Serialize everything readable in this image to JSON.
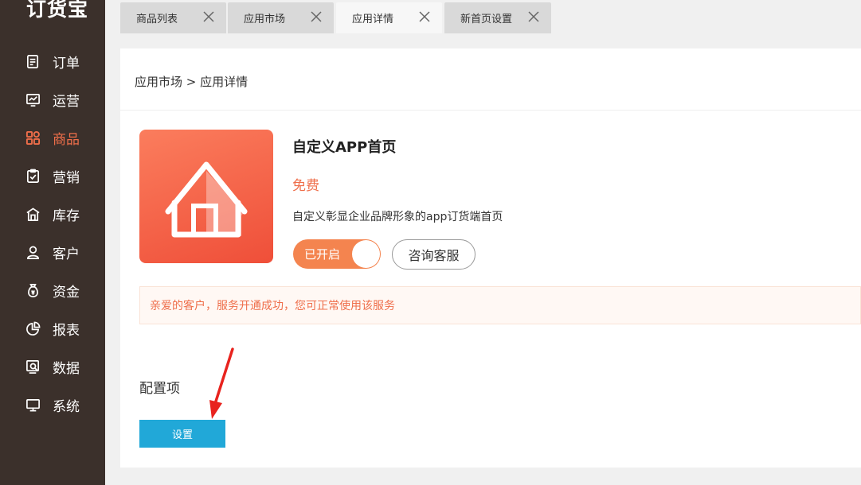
{
  "sidebar": {
    "logo": "订货宝",
    "items": [
      {
        "label": "订单",
        "icon": "order-icon"
      },
      {
        "label": "运营",
        "icon": "operations-chart-icon"
      },
      {
        "label": "商品",
        "icon": "grid-icon",
        "active": true
      },
      {
        "label": "营销",
        "icon": "clipboard-check-icon"
      },
      {
        "label": "库存",
        "icon": "warehouse-icon"
      },
      {
        "label": "客户",
        "icon": "user-icon"
      },
      {
        "label": "资金",
        "icon": "money-bag-icon"
      },
      {
        "label": "报表",
        "icon": "pie-chart-icon"
      },
      {
        "label": "数据",
        "icon": "data-search-icon"
      },
      {
        "label": "系统",
        "icon": "monitor-icon"
      }
    ],
    "active_color": "#ef6e4a"
  },
  "tabs": [
    {
      "label": "商品列表"
    },
    {
      "label": "应用市场"
    },
    {
      "label": "应用详情",
      "active": true
    },
    {
      "label": "新首页设置"
    }
  ],
  "breadcrumb": "应用市场 > 应用详情",
  "app": {
    "title": "自定义APP首页",
    "price": "免费",
    "description": "自定义彰显企业品牌形象的app订货端首页",
    "icon": "house-icon",
    "toggle_label": "已开启",
    "consult_label": "咨询客服"
  },
  "notice": "亲爱的客户，服务开通成功，您可正常使用该服务",
  "config": {
    "title": "配置项",
    "settings_label": "设置"
  },
  "colors": {
    "accent": "#ef6e4a",
    "button_blue": "#21a8d8",
    "sidebar_bg": "#3b302b"
  }
}
